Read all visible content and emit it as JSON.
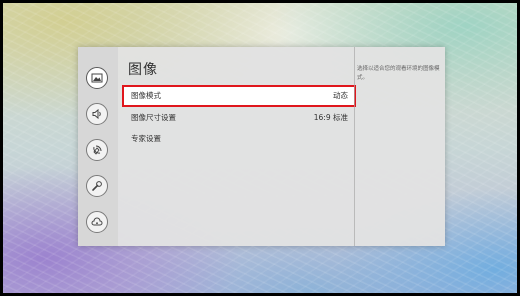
{
  "menu": {
    "title": "图像",
    "sidebar": [
      {
        "icon": "picture-icon",
        "active": true
      },
      {
        "icon": "speaker-icon",
        "active": false
      },
      {
        "icon": "broadcast-icon",
        "active": false
      },
      {
        "icon": "wrench-icon",
        "active": false
      },
      {
        "icon": "cloud-icon",
        "active": false
      }
    ],
    "rows": [
      {
        "label": "图像模式",
        "value": "动态"
      },
      {
        "label": "图像尺寸设置",
        "value": "16:9 标准"
      },
      {
        "label": "专家设置",
        "value": ""
      }
    ],
    "help_text": "选择以适合您的观看环境的图像模式。"
  },
  "colors": {
    "highlight": "#e0161c",
    "panel": "#e2e2e2"
  }
}
